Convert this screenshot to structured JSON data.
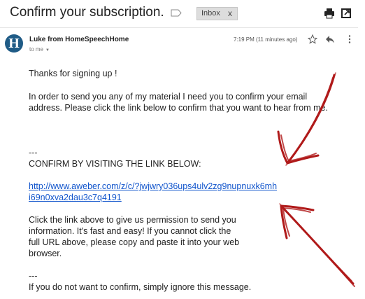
{
  "header": {
    "subject": "Confirm your subscription.",
    "label": "Inbox",
    "label_remove": "x"
  },
  "icons": {
    "label": "label-outline-icon",
    "print": "print-icon",
    "new_window": "open-in-new-window-icon",
    "star": "star-icon",
    "reply": "reply-icon",
    "more": "more-vert-icon"
  },
  "message": {
    "avatar_letter": "H",
    "sender": "Luke from HomeSpeechHome",
    "recipient": "to me",
    "time": "7:19 PM (11 minutes ago)"
  },
  "body": {
    "greeting": "Thanks for signing up !",
    "intro_line1": "In order to send you any of my material I need you to confirm your email",
    "intro_line2": "address. Please click the link below to confirm that you want to hear from me.",
    "separator1": "---",
    "confirm_heading": "CONFIRM BY VISITING THE LINK BELOW:",
    "link_line1": "http://www.aweber.com/z/c/?jwjwry036ups4ulv2zg9nupnuxk6mh",
    "link_line2": "i69n0xva2dau3c7q4191",
    "para_line1": "Click the link above to give us permission to send you",
    "para_line2": "information.  It's fast and easy!  If you cannot click the",
    "para_line3": "full URL above, please copy and paste it into your web",
    "para_line4": "browser.",
    "separator2": "---",
    "ignore_line": "If you do not want to confirm, simply ignore this message."
  },
  "colors": {
    "link": "#1155cc",
    "avatar_bg": "#1f5b86",
    "annotation_arrows": "#b01a1a",
    "chip_bg": "#dddddd"
  }
}
